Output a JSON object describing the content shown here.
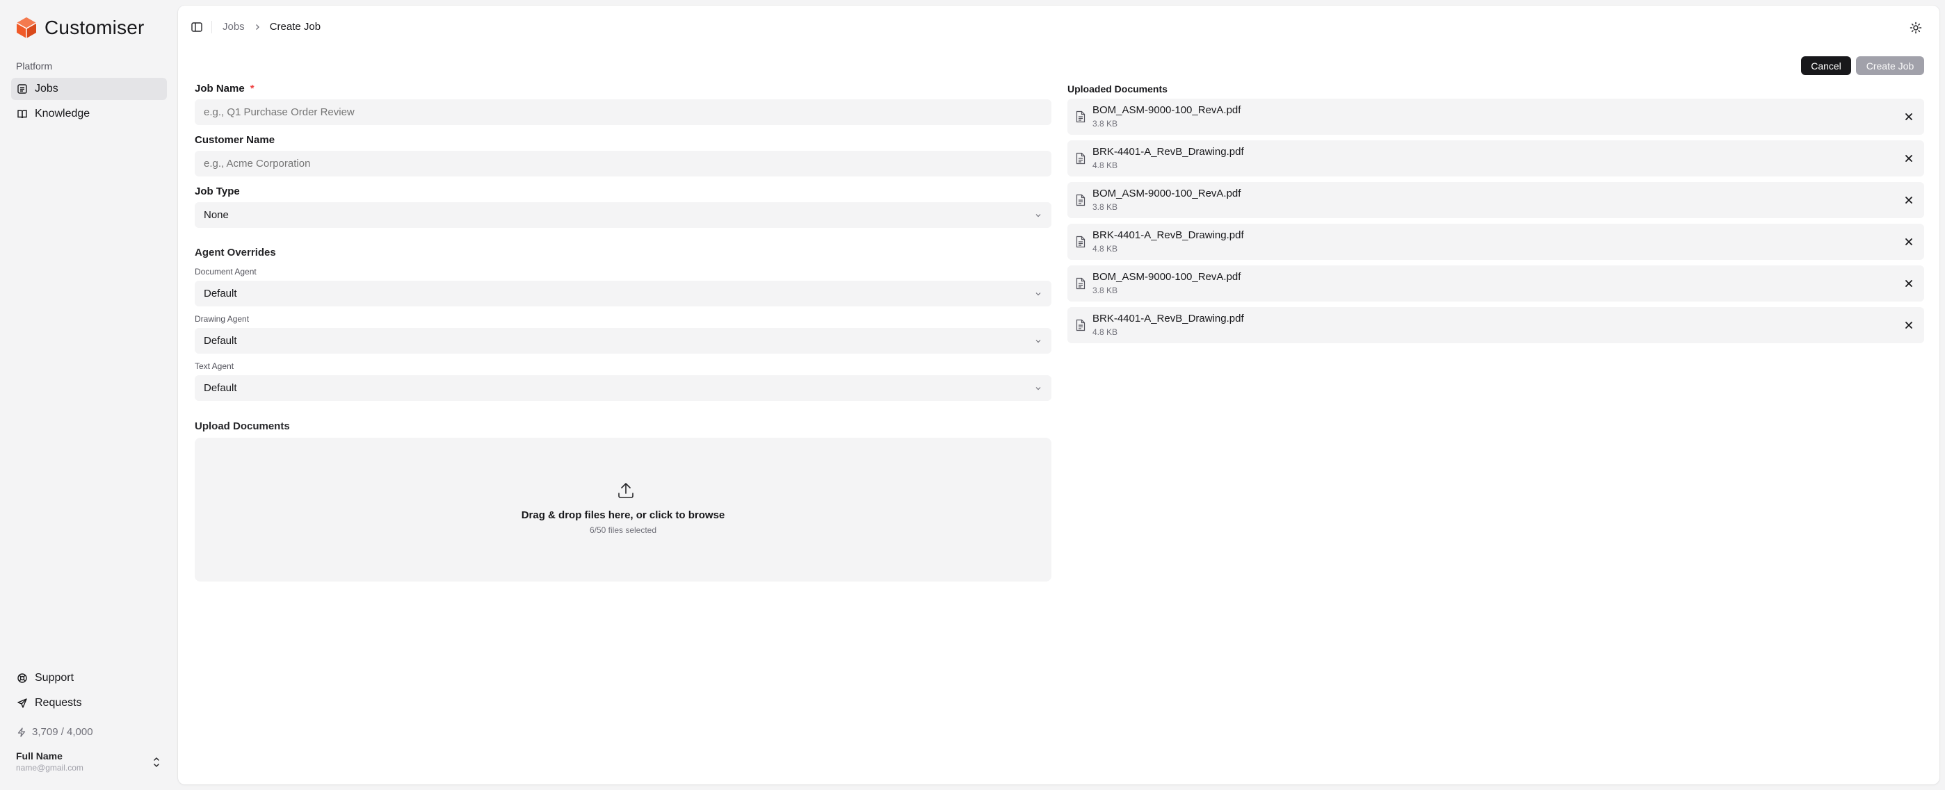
{
  "app": {
    "name": "Customiser"
  },
  "sidebar": {
    "section_label": "Platform",
    "items": [
      {
        "label": "Jobs",
        "icon": "list-icon",
        "active": true
      },
      {
        "label": "Knowledge",
        "icon": "book-icon",
        "active": false
      }
    ],
    "footer_items": [
      {
        "label": "Support",
        "icon": "lifebuoy-icon"
      },
      {
        "label": "Requests",
        "icon": "send-icon"
      }
    ],
    "credits": "3,709 / 4,000",
    "user": {
      "name": "Full Name",
      "email": "name@gmail.com"
    }
  },
  "breadcrumb": {
    "parent": "Jobs",
    "current": "Create Job"
  },
  "actions": {
    "cancel": "Cancel",
    "create": "Create Job"
  },
  "form": {
    "job_name": {
      "label": "Job Name",
      "required": "*",
      "placeholder": "e.g., Q1 Purchase Order Review",
      "value": ""
    },
    "customer_name": {
      "label": "Customer Name",
      "placeholder": "e.g., Acme Corporation",
      "value": ""
    },
    "job_type": {
      "label": "Job Type",
      "value": "None"
    },
    "agent_overrides": {
      "title": "Agent Overrides",
      "document_agent": {
        "label": "Document Agent",
        "value": "Default"
      },
      "drawing_agent": {
        "label": "Drawing Agent",
        "value": "Default"
      },
      "text_agent": {
        "label": "Text Agent",
        "value": "Default"
      }
    },
    "upload": {
      "title": "Upload Documents",
      "prompt": "Drag & drop files here, or click to browse",
      "count": "6/50 files selected"
    }
  },
  "uploaded": {
    "title": "Uploaded Documents",
    "files": [
      {
        "name": "BOM_ASM-9000-100_RevA.pdf",
        "size": "3.8 KB"
      },
      {
        "name": "BRK-4401-A_RevB_Drawing.pdf",
        "size": "4.8 KB"
      },
      {
        "name": "BOM_ASM-9000-100_RevA.pdf",
        "size": "3.8 KB"
      },
      {
        "name": "BRK-4401-A_RevB_Drawing.pdf",
        "size": "4.8 KB"
      },
      {
        "name": "BOM_ASM-9000-100_RevA.pdf",
        "size": "3.8 KB"
      },
      {
        "name": "BRK-4401-A_RevB_Drawing.pdf",
        "size": "4.8 KB"
      }
    ]
  },
  "colors": {
    "brand": "#f05a28",
    "primary_button": "#18181b",
    "disabled_button": "#a1a1aa",
    "required": "#ef4444",
    "field_bg": "#f4f4f5"
  }
}
